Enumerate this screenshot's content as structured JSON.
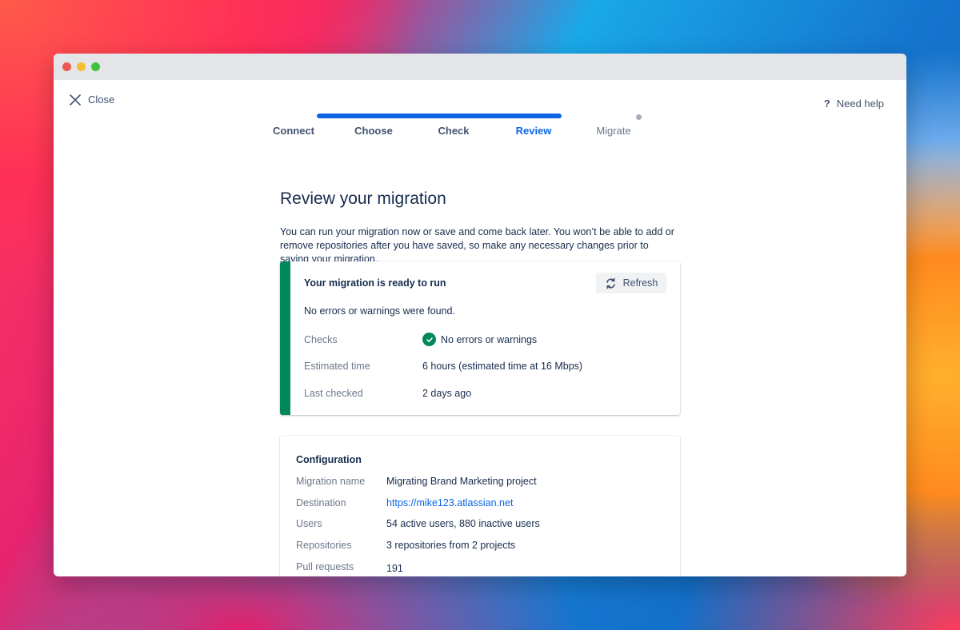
{
  "window": {
    "close_label": "Close",
    "help_label": "Need help",
    "help_icon": "?"
  },
  "stepper": {
    "steps": [
      {
        "label": "Connect",
        "state": "done"
      },
      {
        "label": "Choose",
        "state": "done"
      },
      {
        "label": "Check",
        "state": "done"
      },
      {
        "label": "Review",
        "state": "active"
      },
      {
        "label": "Migrate",
        "state": "todo"
      }
    ],
    "progress_fraction": 0.8,
    "accent_color": "#0c66e4"
  },
  "main": {
    "title": "Review your migration",
    "intro": "You can run your migration now or save and come back later. You won’t be able to add or remove repositories after you have saved, so make any necessary changes prior to saving your migration."
  },
  "status": {
    "heading": "Your migration is ready to run",
    "refresh_label": "Refresh",
    "subtitle": "No errors or warnings were found.",
    "status_color": "#00875a",
    "rows": [
      {
        "label": "Checks",
        "value": "No errors or warnings",
        "icon": "check-circle-icon"
      },
      {
        "label": "Estimated time",
        "value": "6 hours (estimated time at 16 Mbps)"
      },
      {
        "label": "Last checked",
        "value": "2 days ago"
      }
    ]
  },
  "configuration": {
    "title": "Configuration",
    "rows": [
      {
        "label": "Migration name",
        "value": "Migrating Brand Marketing project"
      },
      {
        "label": "Destination",
        "value": "https://mike123.atlassian.net",
        "is_link": true
      },
      {
        "label": "Users",
        "value": "54 active users, 880 inactive users"
      },
      {
        "label": "Repositories",
        "value": "3 repositories from 2 projects"
      },
      {
        "label": "Pull requests",
        "value": "191"
      }
    ]
  }
}
